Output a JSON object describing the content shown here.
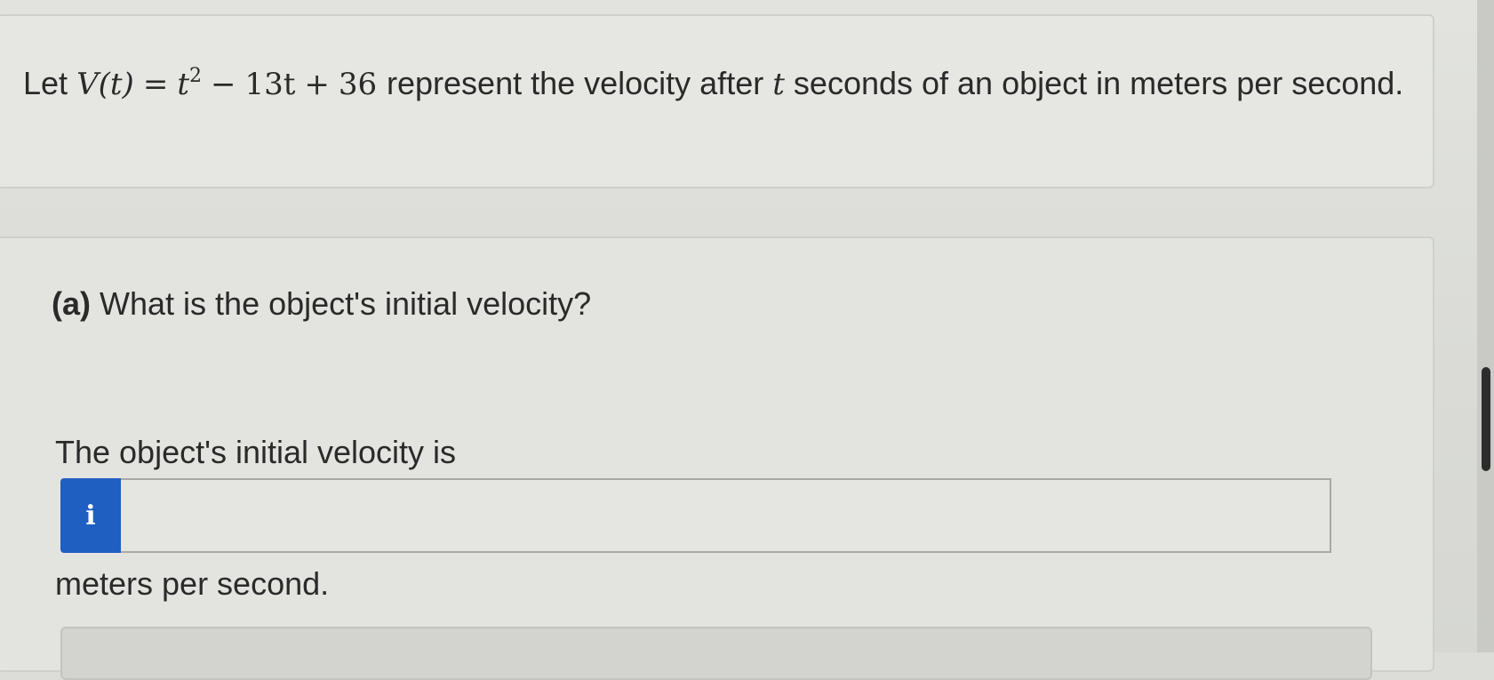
{
  "problem": {
    "prefix": "Let",
    "equation": {
      "lhs": "V(t)",
      "eq": "=",
      "t_squared_base": "t",
      "t_squared_exp": "2",
      "minus": "−",
      "middle_term": "13t",
      "plus": "+",
      "constant": "36"
    },
    "text_before_var": "represent the velocity after",
    "variable": "t",
    "text_after_var": "seconds of an object in meters per second."
  },
  "part_a": {
    "marker": "(a)",
    "question": "What is the object's initial velocity?",
    "answer_prompt": "The object's initial velocity is",
    "info_button_label": "i",
    "answer_value": "",
    "answer_placeholder": "",
    "unit_text": "meters per second."
  },
  "colors": {
    "info_button": "#1f5fc2",
    "background": "#dcddd9",
    "text": "#2a2a2a"
  }
}
